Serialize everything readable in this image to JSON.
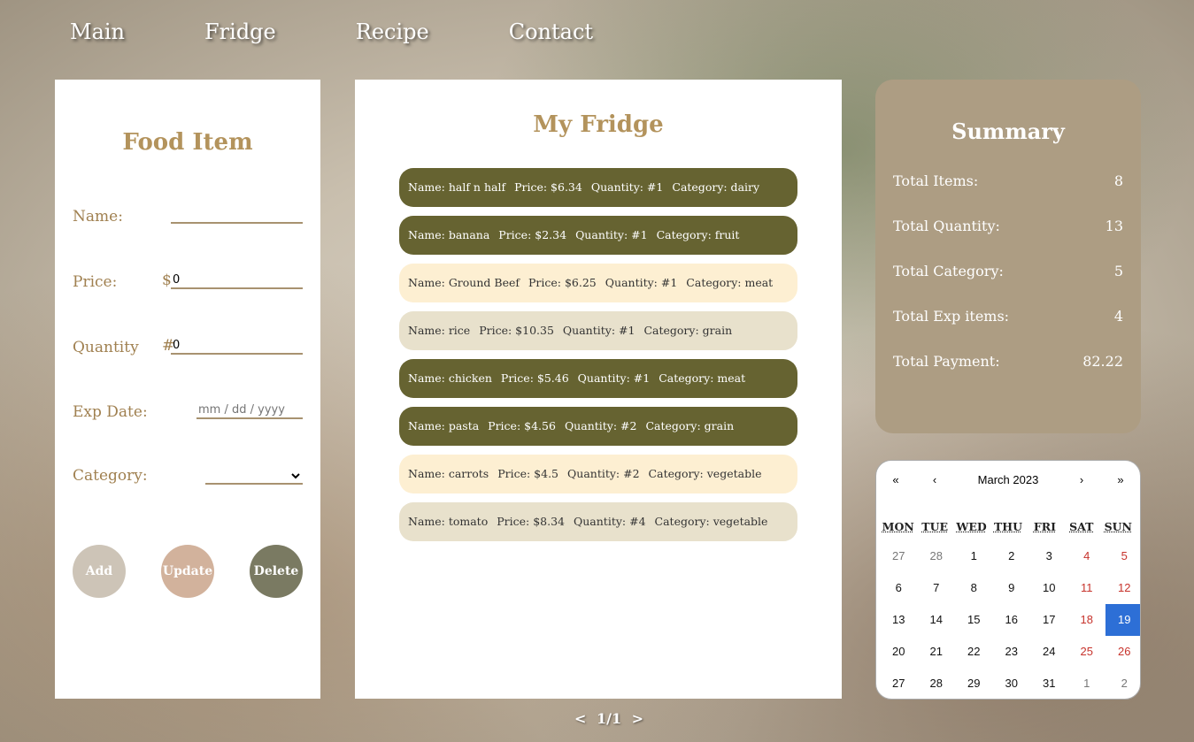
{
  "nav": [
    "Main",
    "Fridge",
    "Recipe",
    "Contact"
  ],
  "food_form": {
    "title": "Food Item",
    "name_label": "Name:",
    "price_label": "Price:",
    "price_prefix": "$",
    "price_value": "0",
    "quantity_label": "Quantity",
    "quantity_prefix": "#",
    "quantity_value": "0",
    "exp_label": "Exp Date:",
    "exp_placeholder": "mm / dd / yyyy",
    "category_label": "Category:",
    "add_label": "Add",
    "update_label": "Update",
    "delete_label": "Delete"
  },
  "fridge": {
    "title": "My Fridge",
    "items": [
      {
        "name": "Name: half n half",
        "price": "Price: $6.34",
        "qty": "Quantity: #1",
        "cat": "Category: dairy",
        "style": "olive"
      },
      {
        "name": "Name: banana",
        "price": "Price: $2.34",
        "qty": "Quantity: #1",
        "cat": "Category: fruit",
        "style": "olive"
      },
      {
        "name": "Name: Ground Beef",
        "price": "Price: $6.25",
        "qty": "Quantity: #1",
        "cat": "Category: meat",
        "style": "cream"
      },
      {
        "name": "Name: rice",
        "price": "Price: $10.35",
        "qty": "Quantity: #1",
        "cat": "Category: grain",
        "style": "beige"
      },
      {
        "name": "Name: chicken",
        "price": "Price: $5.46",
        "qty": "Quantity: #1",
        "cat": "Category: meat",
        "style": "olive"
      },
      {
        "name": "Name: pasta",
        "price": "Price: $4.56",
        "qty": "Quantity: #2",
        "cat": "Category: grain",
        "style": "olive"
      },
      {
        "name": "Name: carrots",
        "price": "Price: $4.5",
        "qty": "Quantity: #2",
        "cat": "Category: vegetable",
        "style": "cream"
      },
      {
        "name": "Name: tomato",
        "price": "Price: $8.34",
        "qty": "Quantity: #4",
        "cat": "Category: vegetable",
        "style": "beige"
      }
    ]
  },
  "pager": {
    "prev": "<",
    "page": "1/1",
    "next": ">"
  },
  "summary": {
    "title": "Summary",
    "rows": [
      {
        "label": "Total Items:",
        "value": "8"
      },
      {
        "label": "Total Quantity:",
        "value": "13"
      },
      {
        "label": "Total Category:",
        "value": "5"
      },
      {
        "label": "Total Exp items:",
        "value": "4"
      },
      {
        "label": "Total Payment:",
        "value": "82.22"
      }
    ]
  },
  "calendar": {
    "first": "«",
    "prev": "‹",
    "month": "March 2023",
    "next": "›",
    "last": "»",
    "dow": [
      "MON",
      "TUE",
      "WED",
      "THU",
      "FRI",
      "SAT",
      "SUN"
    ],
    "days": [
      {
        "d": "27",
        "t": "other"
      },
      {
        "d": "28",
        "t": "other"
      },
      {
        "d": "1",
        "t": ""
      },
      {
        "d": "2",
        "t": ""
      },
      {
        "d": "3",
        "t": ""
      },
      {
        "d": "4",
        "t": "wk"
      },
      {
        "d": "5",
        "t": "wk"
      },
      {
        "d": "6",
        "t": ""
      },
      {
        "d": "7",
        "t": ""
      },
      {
        "d": "8",
        "t": ""
      },
      {
        "d": "9",
        "t": ""
      },
      {
        "d": "10",
        "t": ""
      },
      {
        "d": "11",
        "t": "wk"
      },
      {
        "d": "12",
        "t": "wk"
      },
      {
        "d": "13",
        "t": ""
      },
      {
        "d": "14",
        "t": ""
      },
      {
        "d": "15",
        "t": ""
      },
      {
        "d": "16",
        "t": ""
      },
      {
        "d": "17",
        "t": ""
      },
      {
        "d": "18",
        "t": "wk"
      },
      {
        "d": "19",
        "t": "sel"
      },
      {
        "d": "20",
        "t": ""
      },
      {
        "d": "21",
        "t": ""
      },
      {
        "d": "22",
        "t": ""
      },
      {
        "d": "23",
        "t": ""
      },
      {
        "d": "24",
        "t": ""
      },
      {
        "d": "25",
        "t": "wk"
      },
      {
        "d": "26",
        "t": "wk"
      },
      {
        "d": "27",
        "t": ""
      },
      {
        "d": "28",
        "t": ""
      },
      {
        "d": "29",
        "t": ""
      },
      {
        "d": "30",
        "t": ""
      },
      {
        "d": "31",
        "t": ""
      },
      {
        "d": "1",
        "t": "other"
      },
      {
        "d": "2",
        "t": "other"
      }
    ]
  },
  "colors": {
    "olive": "#666331",
    "cream": "#fdefd2",
    "beige": "#e8e1cc",
    "accent": "#b3935c",
    "summary_bg": "#ad9d83",
    "selected_day": "#2d6fd6",
    "add_btn": "#cdc4b7",
    "update_btn": "#d2b29c",
    "delete_btn": "#7a7a62"
  }
}
